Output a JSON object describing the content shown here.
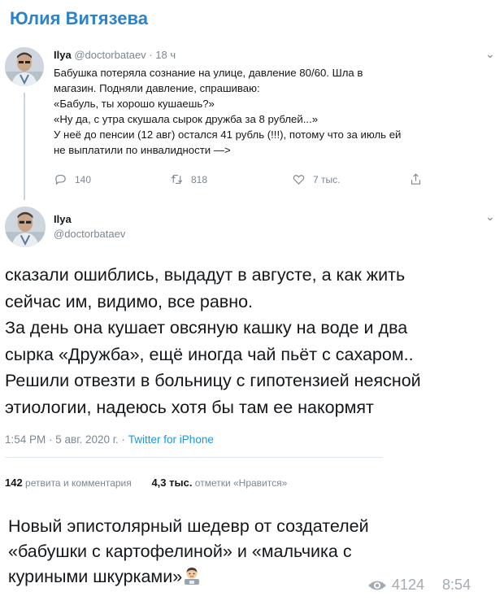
{
  "channel": {
    "title": "Юлия Витязева"
  },
  "parent_tweet": {
    "name": "Ilya",
    "handle": "@doctorbataev",
    "separator": "·",
    "time": "18 ч",
    "lines": [
      "Бабушка потеряла сознание на улице, давление 80/60. Шла в",
      "магазин. Подняли давление, спрашиваю:",
      "«Бабуль, ты хорошо кушаешь?»",
      "«Ну да, с утра скушала сырок дружба за 8 рублей...»",
      "У неё до пенсии (12 авг) остался 41 рубль (!!!), потому что за июль ей",
      "не выплатили по инвалидности —>"
    ],
    "actions": {
      "replies": "140",
      "retweets": "818",
      "likes": "7 тыс.",
      "reply_icon": "reply-icon",
      "retweet_icon": "retweet-icon",
      "like_icon": "heart-icon",
      "share_icon": "share-icon"
    }
  },
  "main_tweet": {
    "name": "Ilya",
    "handle": "@doctorbataev",
    "lines": [
      "сказали ошиблись, выдадут в августе, а как жить",
      "сейчас им, видимо, все равно.",
      "За день она кушает овсяную кашку на воде и два",
      "сырка «Дружба», ещё иногда чай пьёт с сахаром..",
      "Решили отвезти в больницу с гипотензией неясной",
      "этиологии, надеюсь хотя бы там ее накормят"
    ],
    "timestamp": "1:54 PM · 5 авг. 2020 г. · ",
    "source": "Twitter for iPhone",
    "stats": {
      "retweets_count": "142",
      "retweets_label": "ретвита и комментария",
      "likes_count": "4,3 тыс.",
      "likes_label": "отметки «Нравится»"
    }
  },
  "caption": {
    "lines": [
      "Новый эпистолярный шедевр от создателей",
      "«бабушки с картофелиной» и «мальчика с",
      "куриными шкурками»"
    ],
    "emoji": "man-technologist-emoji"
  },
  "post_meta": {
    "views": "4124",
    "time": "8:54",
    "views_icon": "eye-icon"
  },
  "colors": {
    "channel_title": "#2d82c8",
    "link": "#1b95e0",
    "muted": "#7a8791"
  }
}
